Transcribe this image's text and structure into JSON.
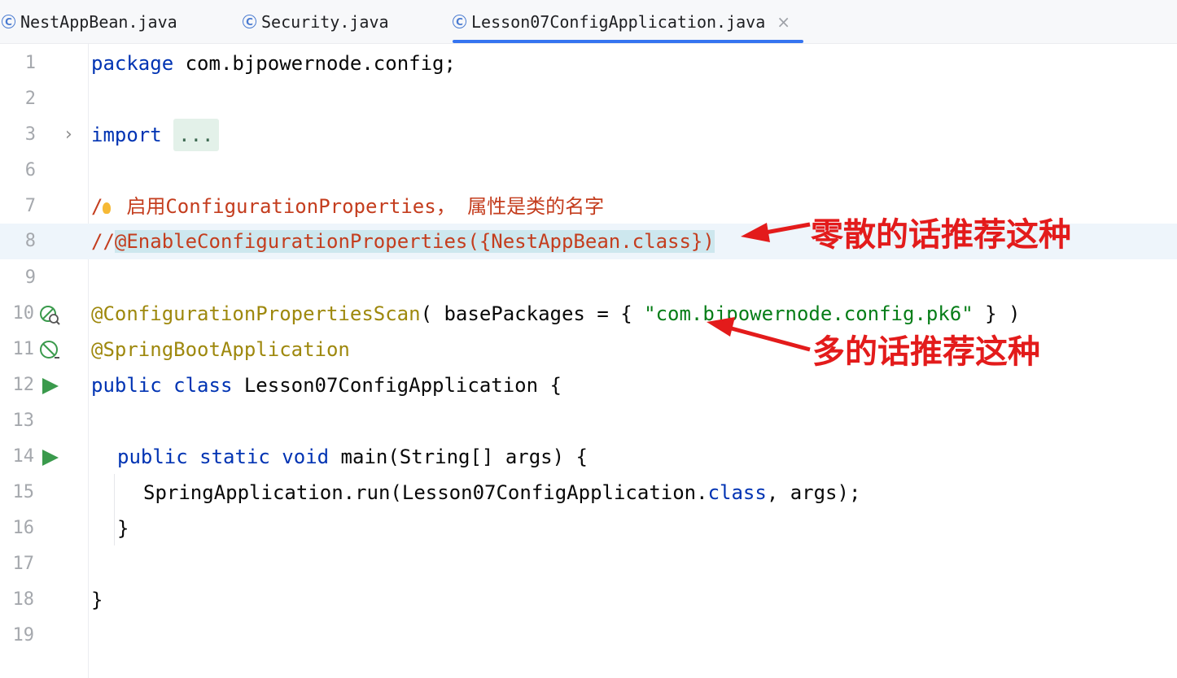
{
  "tabs": [
    {
      "label": "NestAppBean.java",
      "active": false
    },
    {
      "label": "Security.java",
      "active": false
    },
    {
      "label": "Lesson07ConfigApplication.java",
      "active": true,
      "close": "×"
    }
  ],
  "lines": [
    {
      "num": "1"
    },
    {
      "num": "2"
    },
    {
      "num": "3"
    },
    {
      "num": "6"
    },
    {
      "num": "7"
    },
    {
      "num": "8"
    },
    {
      "num": "9"
    },
    {
      "num": "10"
    },
    {
      "num": "11"
    },
    {
      "num": "12"
    },
    {
      "num": "13"
    },
    {
      "num": "14"
    },
    {
      "num": "15"
    },
    {
      "num": "16"
    },
    {
      "num": "17"
    },
    {
      "num": "18"
    },
    {
      "num": "19"
    }
  ],
  "code": {
    "l1_kw": "package",
    "l1_rest": " com.bjpowernode.config;",
    "l3_kw": "import",
    "l3_fold": "...",
    "l7_prefix": "/",
    "l7_text": "启用ConfigurationProperties， 属性是类的名字",
    "l8_prefix": "//",
    "l8_sel": "@EnableConfigurationProperties({NestAppBean.class})",
    "l10_ann": "@ConfigurationPropertiesScan",
    "l10_mid": "( basePackages = { ",
    "l10_str": "\"com.bjpowernode.config.pk6\"",
    "l10_end": " } )",
    "l11_ann": "@SpringBootApplication",
    "l12_kw": "public class",
    "l12_rest": " Lesson07ConfigApplication {",
    "l14_kw": "public static void",
    "l14_rest": " main(String[] args) {",
    "l15_a": "SpringApplication.run(Lesson07ConfigApplication.",
    "l15_kw": "class",
    "l15_b": ", args);",
    "l16": "}",
    "l18": "}"
  },
  "annotations": {
    "note1": "零散的话推荐这种",
    "note2": "多的话推荐这种",
    "color": "#e31b1b"
  },
  "colors": {
    "keyword": "#0033b3",
    "annotation": "#9e880d",
    "string": "#067d17",
    "comment": "#c43d1e",
    "run": "#3a9a4c"
  }
}
